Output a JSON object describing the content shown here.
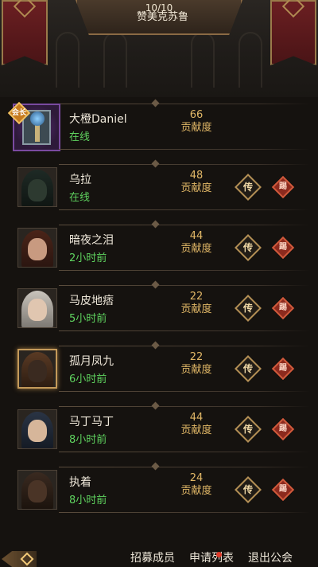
{
  "header": {
    "guild_name": "赞美克苏鲁",
    "member_count": "10/10"
  },
  "leader_badge": "会长",
  "members": [
    {
      "name": "大橙Daniel",
      "status": "在线",
      "contribution": "66",
      "contribution_label": "贡献度",
      "leader": true
    },
    {
      "name": "乌拉",
      "status": "在线",
      "contribution": "48",
      "contribution_label": "贡献度",
      "transfer_label": "传",
      "kick_label": "踢"
    },
    {
      "name": "暗夜之泪",
      "status": "2小时前",
      "contribution": "44",
      "contribution_label": "贡献度",
      "transfer_label": "传",
      "kick_label": "踢"
    },
    {
      "name": "马皮地痞",
      "status": "5小时前",
      "contribution": "22",
      "contribution_label": "贡献度",
      "transfer_label": "传",
      "kick_label": "踢"
    },
    {
      "name": "孤月凤九",
      "status": "6小时前",
      "contribution": "22",
      "contribution_label": "贡献度",
      "transfer_label": "传",
      "kick_label": "踢"
    },
    {
      "name": "马丁马丁",
      "status": "8小时前",
      "contribution": "44",
      "contribution_label": "贡献度",
      "transfer_label": "传",
      "kick_label": "踢"
    },
    {
      "name": "执着",
      "status": "8小时前",
      "contribution": "24",
      "contribution_label": "贡献度",
      "transfer_label": "传",
      "kick_label": "踢"
    }
  ],
  "bottom_bar": {
    "recruit_label": "招募成员",
    "applications_label": "申请列表",
    "leave_label": "退出公会"
  },
  "colors": {
    "online": "#5fd35f",
    "offline": "#5fd35f",
    "contribution": "#e2b867",
    "kick": "#8c2a1e",
    "accent": "#b38f55"
  }
}
